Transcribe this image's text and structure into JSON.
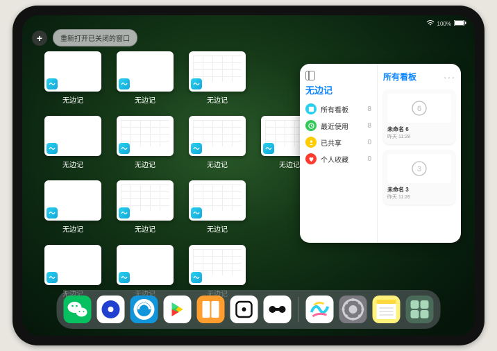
{
  "status": {
    "battery": "100%"
  },
  "toolbar": {
    "add_label": "+",
    "reopen_label": "重新打开已关闭的窗口"
  },
  "expose": {
    "app_label": "无边记",
    "windows": [
      {
        "blank": true
      },
      {
        "blank": true
      },
      {
        "blank": false
      },
      {
        "blank": true
      },
      {
        "blank": false
      },
      {
        "blank": false
      },
      {
        "blank": false
      },
      {
        "blank": true
      },
      {
        "blank": false
      },
      {
        "blank": false
      },
      {
        "blank": true
      },
      {
        "blank": true
      },
      {
        "blank": false
      }
    ]
  },
  "panel": {
    "title": "无边记",
    "right_title": "所有看板",
    "more": "···",
    "categories": [
      {
        "label": "所有看板",
        "count": 8,
        "color": "#2ad0f0",
        "icon": "square"
      },
      {
        "label": "最近使用",
        "count": 8,
        "color": "#34c759",
        "icon": "clock"
      },
      {
        "label": "已共享",
        "count": 0,
        "color": "#ffcc00",
        "icon": "person"
      },
      {
        "label": "个人收藏",
        "count": 0,
        "color": "#ff3b30",
        "icon": "heart"
      }
    ],
    "boards": [
      {
        "name": "未命名 6",
        "time": "昨天 11:28",
        "sketch": "6"
      },
      {
        "name": "未命名 3",
        "time": "昨天 11:26",
        "sketch": "3"
      }
    ]
  },
  "dock": [
    {
      "name": "wechat",
      "bg": "#07c160"
    },
    {
      "name": "quark",
      "bg": "#ffffff"
    },
    {
      "name": "qqbrowser",
      "bg": "#1296db"
    },
    {
      "name": "play",
      "bg": "#ffffff"
    },
    {
      "name": "books",
      "bg": "#ff9d2e"
    },
    {
      "name": "dice",
      "bg": "#ffffff"
    },
    {
      "name": "connect",
      "bg": "#ffffff"
    },
    {
      "name": "freeform",
      "bg": "#ffffff"
    },
    {
      "name": "settings",
      "bg": "#7a7a80"
    },
    {
      "name": "notes",
      "bg": "#fff27a"
    },
    {
      "name": "app-library",
      "bg": "#4a6a5a"
    }
  ]
}
